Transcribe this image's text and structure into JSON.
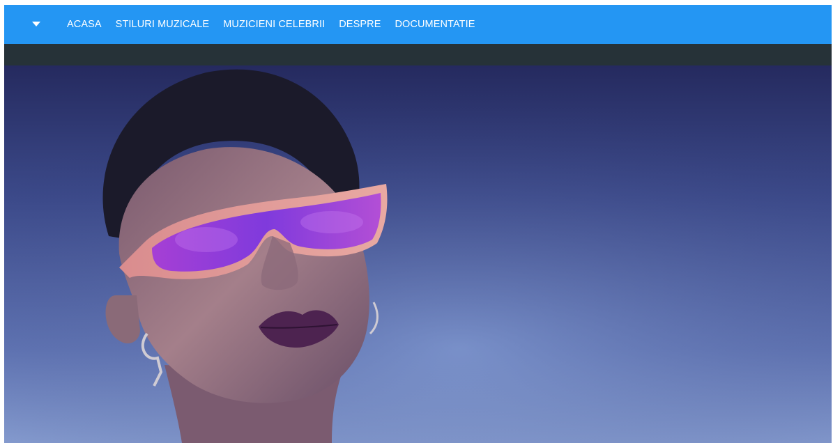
{
  "navbar": {
    "toggle_icon": "caret-down-icon",
    "links": [
      {
        "label": "ACASA"
      },
      {
        "label": "STILURI MUZICALE"
      },
      {
        "label": "MUZICIENI CELEBRII"
      },
      {
        "label": "DESPRE"
      },
      {
        "label": "DOCUMENTATIE"
      }
    ]
  },
  "hero": {
    "image_description": "portrait-photo"
  },
  "colors": {
    "navbar": "#2496f3",
    "subbar": "#263238",
    "hero_top": "#252a5f",
    "hero_bottom": "#8aa1d4"
  }
}
